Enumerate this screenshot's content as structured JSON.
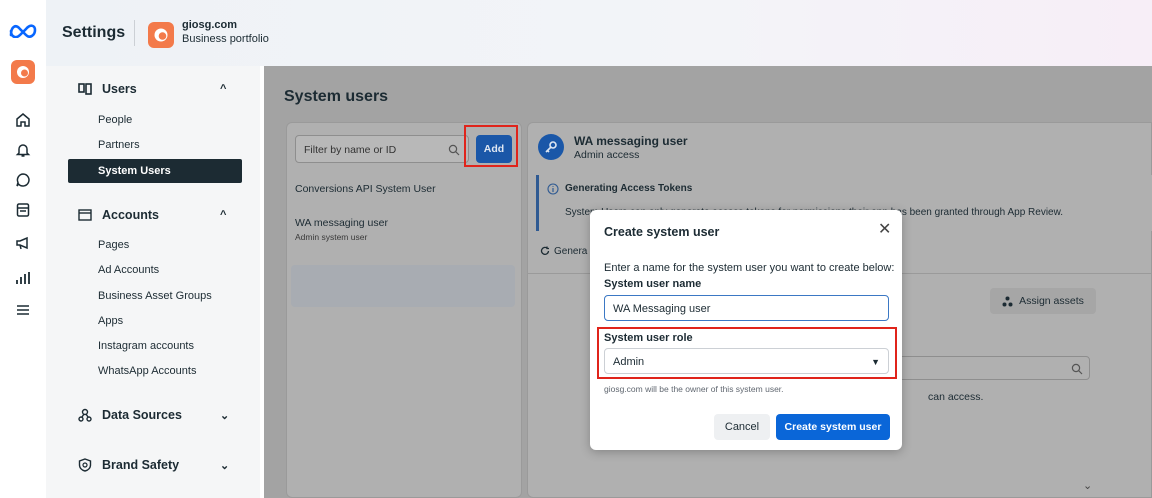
{
  "header": {
    "title": "Settings",
    "portfolio_name": "giosg.com",
    "portfolio_type": "Business portfolio"
  },
  "sidebar": {
    "users_section": "Users",
    "users_items": [
      "People",
      "Partners",
      "System Users"
    ],
    "accounts_section": "Accounts",
    "accounts_items": [
      "Pages",
      "Ad Accounts",
      "Business Asset Groups",
      "Apps",
      "Instagram accounts",
      "WhatsApp Accounts"
    ],
    "data_sources_section": "Data Sources",
    "brand_safety_section": "Brand Safety"
  },
  "main": {
    "heading": "System users",
    "filter_placeholder": "Filter by name or ID",
    "add_label": "Add",
    "list": [
      {
        "name": "Conversions API System User",
        "sub": ""
      },
      {
        "name": "WA messaging user",
        "sub": "Admin system user"
      }
    ],
    "detail": {
      "name": "WA messaging user",
      "access": "Admin access",
      "info_title": "Generating Access Tokens",
      "info_text": "System Users can only generate access tokens for permissions their app has been granted through App Review.",
      "generate_label": "Genera",
      "assign_label": "Assign assets",
      "can_access_text": "can access."
    }
  },
  "modal": {
    "title": "Create system user",
    "description": "Enter a name for the system user you want to create below:",
    "name_label": "System user name",
    "name_value": "WA Messaging user",
    "role_label": "System user role",
    "role_value": "Admin",
    "hint": "giosg.com will be the owner of this system user.",
    "cancel_label": "Cancel",
    "create_label": "Create system user"
  },
  "colors": {
    "primary": "#0a66d8",
    "highlight": "#e0241b",
    "dark": "#1c2b33"
  }
}
